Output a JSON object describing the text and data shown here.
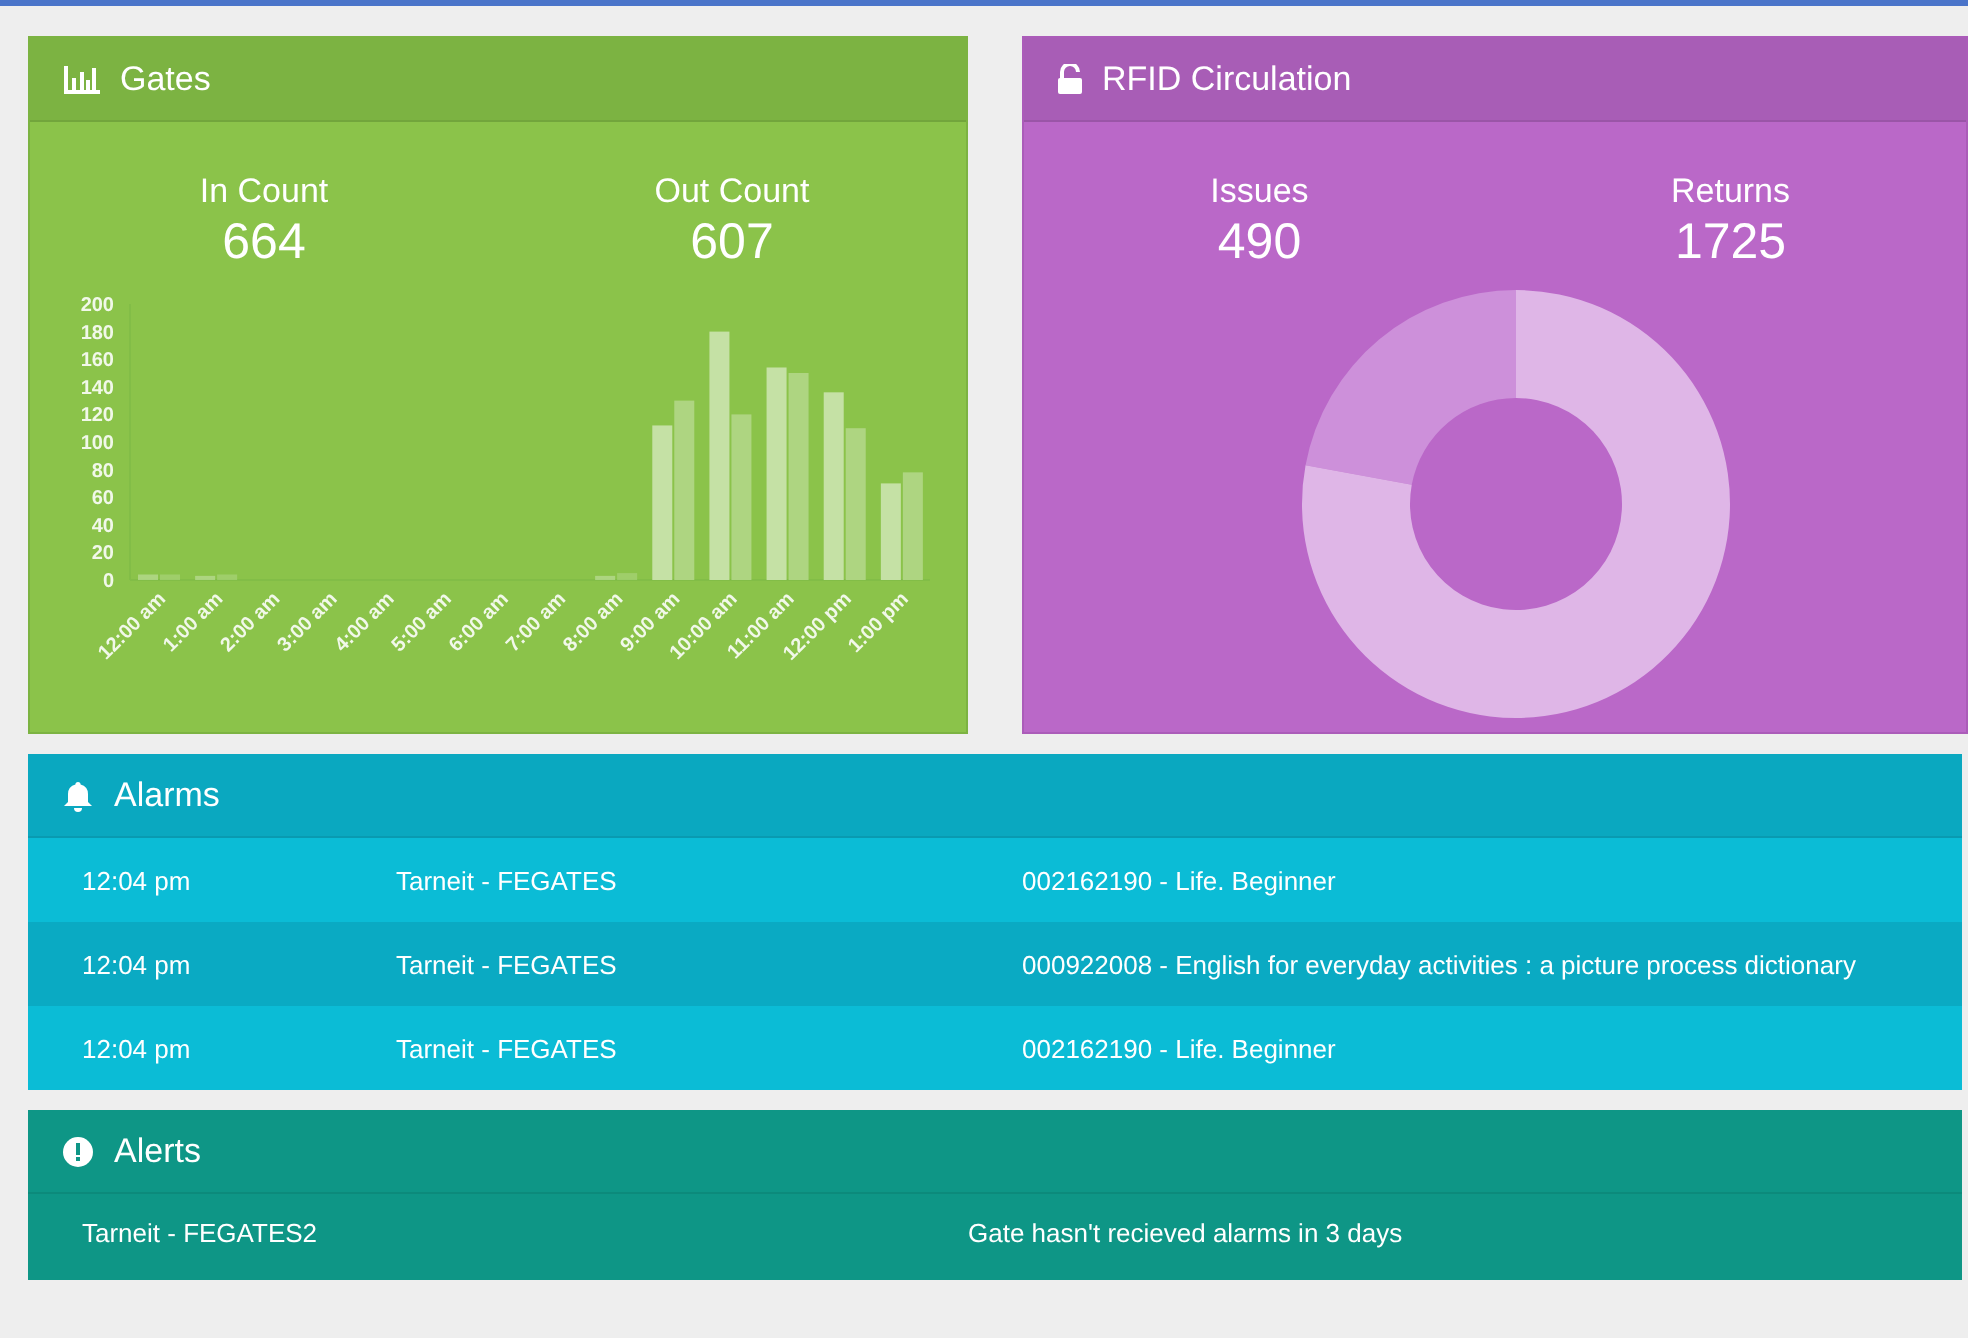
{
  "gates": {
    "title": "Gates",
    "stats": [
      {
        "label": "In Count",
        "value": "664"
      },
      {
        "label": "Out Count",
        "value": "607"
      }
    ],
    "chart_data": {
      "type": "bar",
      "categories": [
        "12:00 am",
        "1:00 am",
        "2:00 am",
        "3:00 am",
        "4:00 am",
        "5:00 am",
        "6:00 am",
        "7:00 am",
        "8:00 am",
        "9:00 am",
        "10:00 am",
        "11:00 am",
        "12:00 pm",
        "1:00 pm"
      ],
      "ylim": [
        0,
        200
      ],
      "yticks": [
        0,
        20,
        40,
        60,
        80,
        100,
        120,
        140,
        160,
        180,
        200
      ],
      "series": [
        {
          "color": "#c5e1a5",
          "values": [
            4,
            3,
            0,
            0,
            0,
            0,
            0,
            0,
            3,
            112,
            180,
            154,
            136,
            70
          ]
        },
        {
          "color": "#aed581",
          "values": [
            4,
            4,
            0,
            0,
            0,
            0,
            0,
            0,
            5,
            130,
            120,
            150,
            110,
            78
          ]
        }
      ]
    }
  },
  "rfid": {
    "title": "RFID Circulation",
    "stats": [
      {
        "label": "Issues",
        "value": "490"
      },
      {
        "label": "Returns",
        "value": "1725"
      }
    ],
    "chart_data": {
      "type": "donut",
      "values": [
        22.1,
        77.9
      ],
      "colors": [
        "#cd90da",
        "#dfb6e7"
      ]
    }
  },
  "alarms": {
    "title": "Alarms",
    "rows": [
      {
        "time": "12:04 pm",
        "location": "Tarneit - FEGATES",
        "item": "002162190 - Life. Beginner"
      },
      {
        "time": "12:04 pm",
        "location": "Tarneit - FEGATES",
        "item": "000922008 - English for everyday activities : a picture process dictionary"
      },
      {
        "time": "12:04 pm",
        "location": "Tarneit - FEGATES",
        "item": "002162190 - Life. Beginner"
      }
    ]
  },
  "alerts": {
    "title": "Alerts",
    "rows": [
      {
        "location": "Tarneit - FEGATES2",
        "message": "Gate hasn't recieved alarms in 3 days"
      }
    ]
  }
}
